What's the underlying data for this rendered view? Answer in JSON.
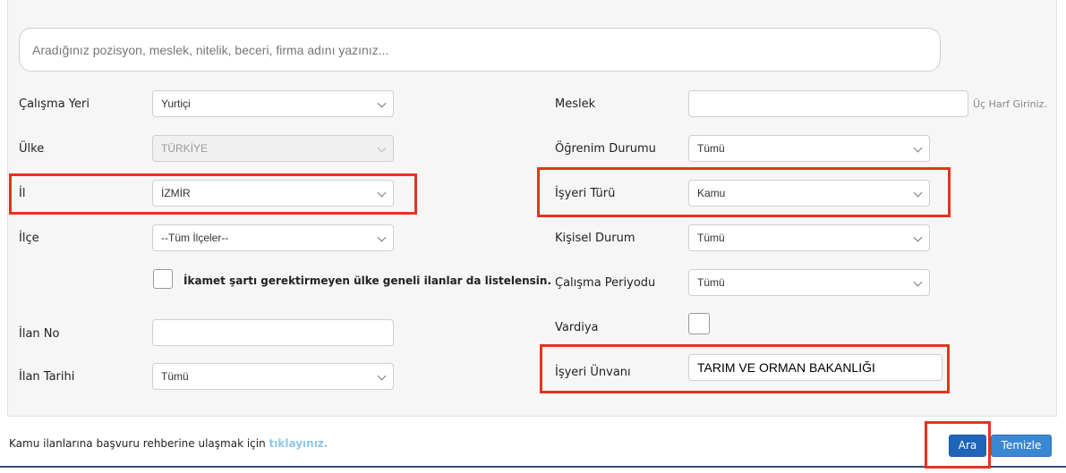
{
  "search": {
    "placeholder": "Aradığınız pozisyon, meslek, nitelik, beceri, firma adını yazınız..."
  },
  "left": {
    "calisma_yeri": {
      "label": "Çalışma Yeri",
      "value": "Yurtiçi"
    },
    "ulke": {
      "label": "Ülke",
      "value": "TÜRKİYE"
    },
    "il": {
      "label": "İl",
      "value": "İZMİR"
    },
    "ilce": {
      "label": "İlçe",
      "value": "--Tüm İlçeler--"
    },
    "ikamet_label": "İkamet şartı gerektirmeyen ülke geneli ilanlar da listelensin.",
    "ilan_no": {
      "label": "İlan No",
      "value": ""
    },
    "ilan_tarihi": {
      "label": "İlan Tarihi",
      "value": "Tümü"
    }
  },
  "right": {
    "meslek": {
      "label": "Meslek",
      "value": "",
      "hint": "Üç Harf Giriniz."
    },
    "ogrenim": {
      "label": "Öğrenim Durumu",
      "value": "Tümü"
    },
    "isyeri_turu": {
      "label": "İşyeri Türü",
      "value": "Kamu"
    },
    "kisisel": {
      "label": "Kişisel Durum",
      "value": "Tümü"
    },
    "periyod": {
      "label": "Çalışma Periyodu",
      "value": "Tümü"
    },
    "vardiya": {
      "label": "Vardiya"
    },
    "isyeri_unvani": {
      "label": "İşyeri Ünvanı",
      "value": "TARIM VE ORMAN BAKANLIĞI"
    }
  },
  "footer": {
    "text": "Kamu ilanlarına başvuru rehberine ulaşmak için",
    "link": "tıklayınız.",
    "search_button": "Ara",
    "clear_button": "Temizle"
  },
  "colors": {
    "highlight": "#e8321e",
    "primary": "#1e64b8",
    "link": "#8ec7e6"
  }
}
